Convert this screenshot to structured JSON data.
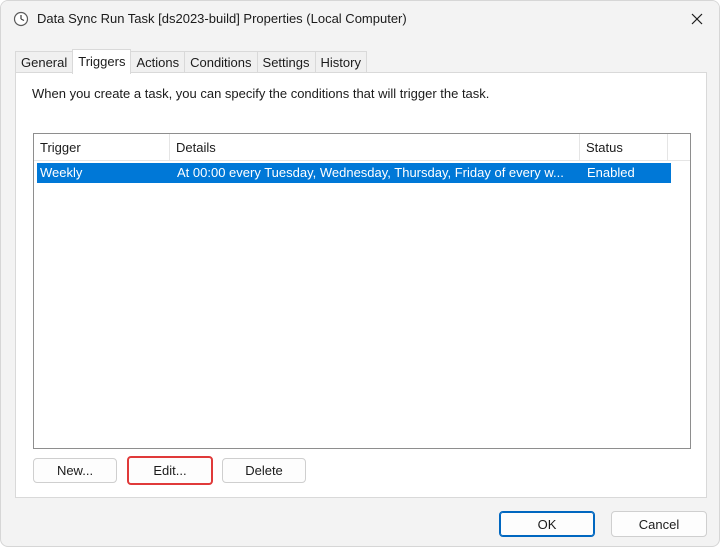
{
  "window": {
    "title": "Data Sync Run Task [ds2023-build] Properties (Local Computer)",
    "title_icon": "clock-icon",
    "close_icon": "close-icon"
  },
  "tabs": [
    {
      "label": "General",
      "active": false
    },
    {
      "label": "Triggers",
      "active": true
    },
    {
      "label": "Actions",
      "active": false
    },
    {
      "label": "Conditions",
      "active": false
    },
    {
      "label": "Settings",
      "active": false
    },
    {
      "label": "History",
      "active": false
    }
  ],
  "triggers_panel": {
    "intro": "When you create a task, you can specify the conditions that will trigger the task.",
    "columns": {
      "trigger": "Trigger",
      "details": "Details",
      "status": "Status"
    },
    "rows": [
      {
        "trigger": "Weekly",
        "details": "At 00:00 every Tuesday, Wednesday, Thursday, Friday of every w...",
        "status": "Enabled",
        "selected": true
      }
    ],
    "buttons": {
      "new": "New...",
      "edit": "Edit...",
      "delete": "Delete"
    }
  },
  "footer": {
    "ok": "OK",
    "cancel": "Cancel"
  },
  "colors": {
    "selection": "#0078d7",
    "highlight_outline": "#e03a3a",
    "primary_border": "#0067c0"
  }
}
